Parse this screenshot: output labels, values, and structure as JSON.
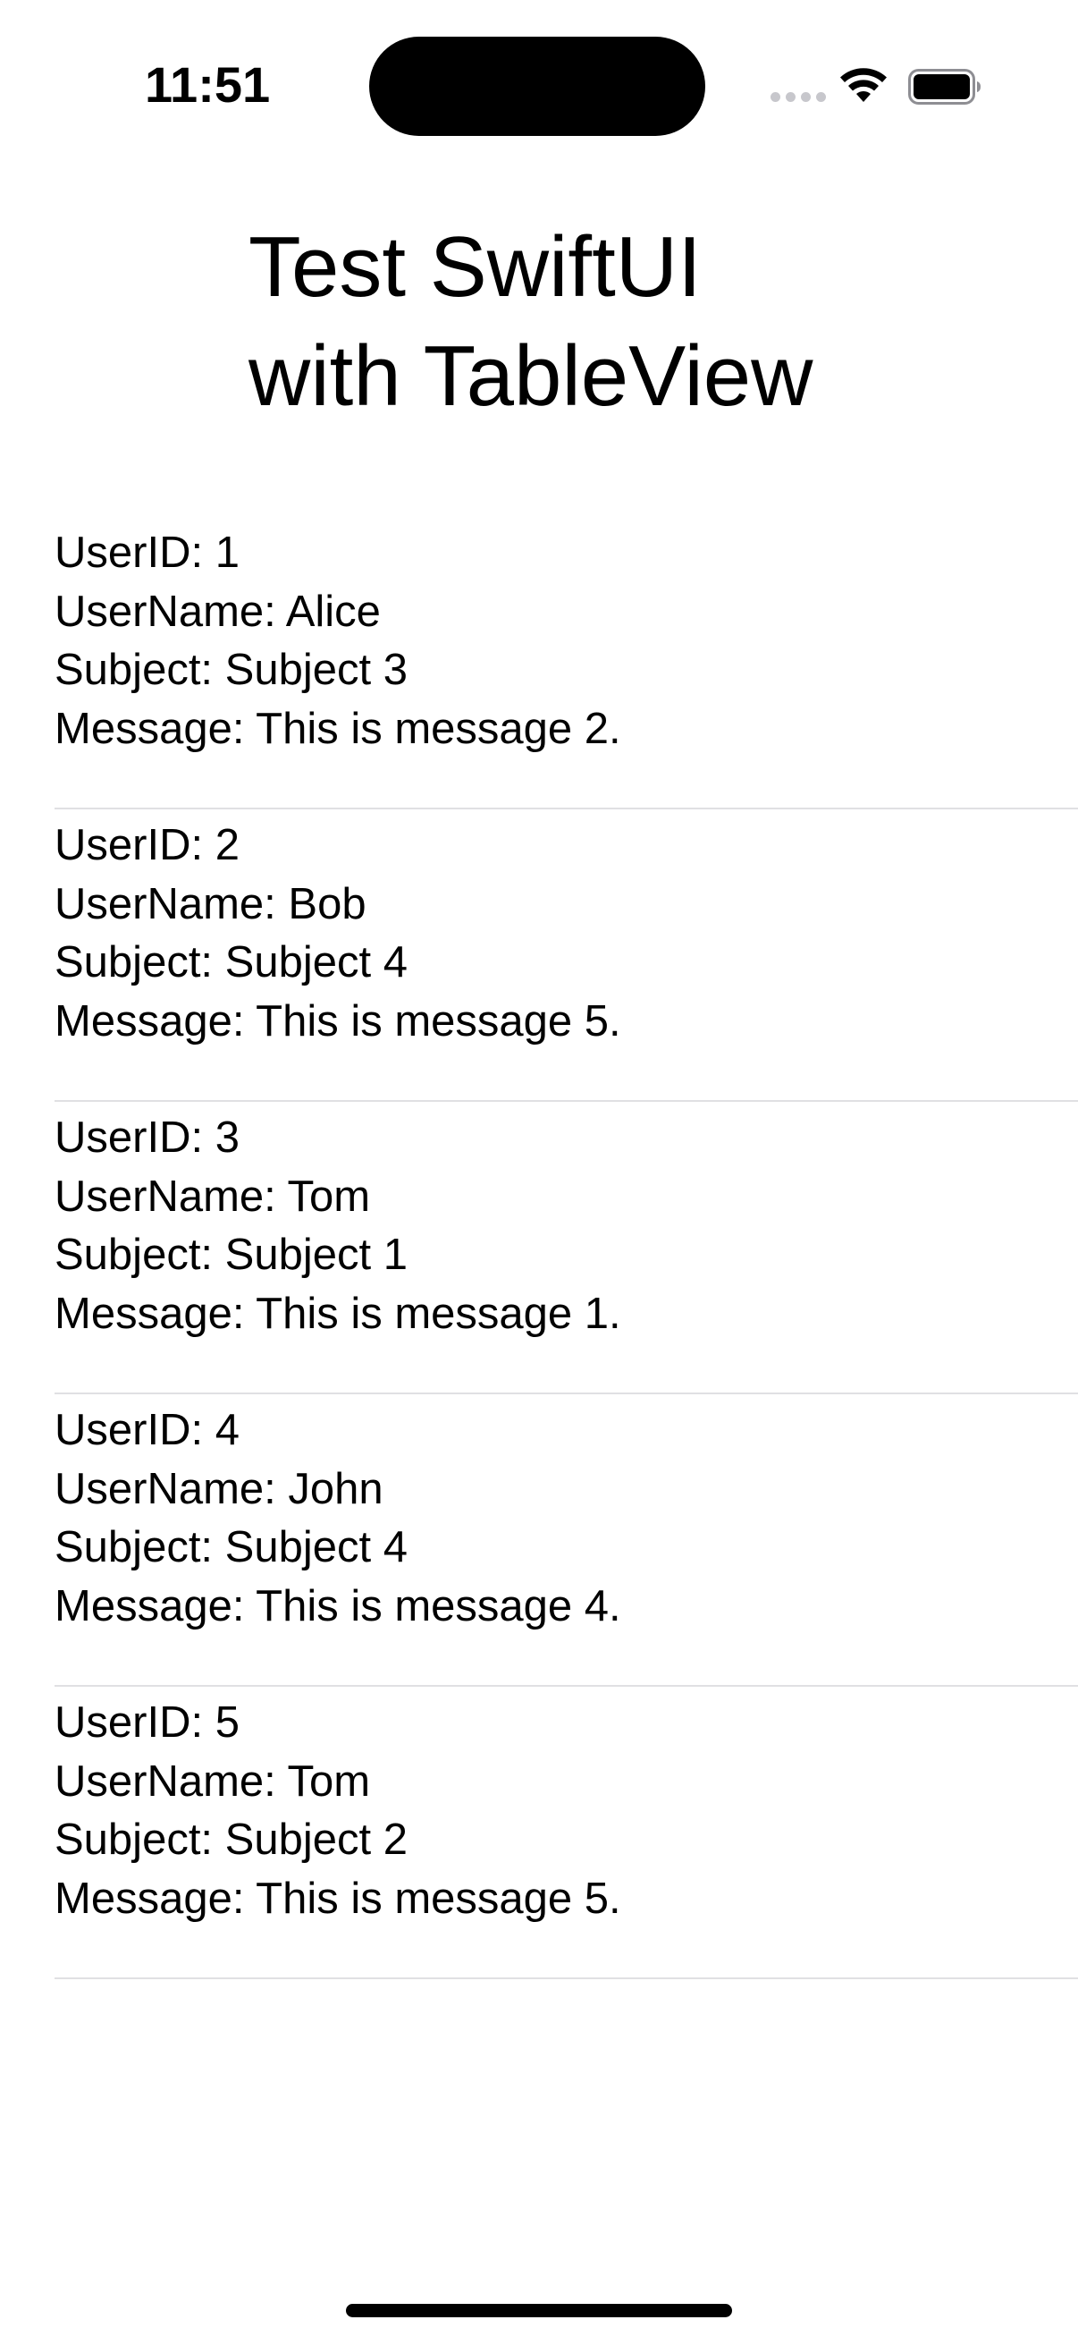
{
  "status_bar": {
    "time": "11:51",
    "icons": [
      "cellular-signal-icon",
      "wifi-icon",
      "battery-icon"
    ]
  },
  "header": {
    "title": "Test SwiftUI\nwith TableView"
  },
  "labels": {
    "user_id": "UserID: ",
    "user_name": "UserName: ",
    "subject": "Subject: ",
    "message": "Message: "
  },
  "rows": [
    {
      "user_id": "1",
      "user_name": "Alice",
      "subject": "Subject 3",
      "message": "This is message 2."
    },
    {
      "user_id": "2",
      "user_name": "Bob",
      "subject": "Subject 4",
      "message": "This is message 5."
    },
    {
      "user_id": "3",
      "user_name": "Tom",
      "subject": "Subject 1",
      "message": "This is message 1."
    },
    {
      "user_id": "4",
      "user_name": "John",
      "subject": "Subject 4",
      "message": "This is message 4."
    },
    {
      "user_id": "5",
      "user_name": "Tom",
      "subject": "Subject 2",
      "message": "This is message 5."
    }
  ],
  "colors": {
    "background": "#ffffff",
    "text": "#000000",
    "separator": "#e0e0e3"
  }
}
